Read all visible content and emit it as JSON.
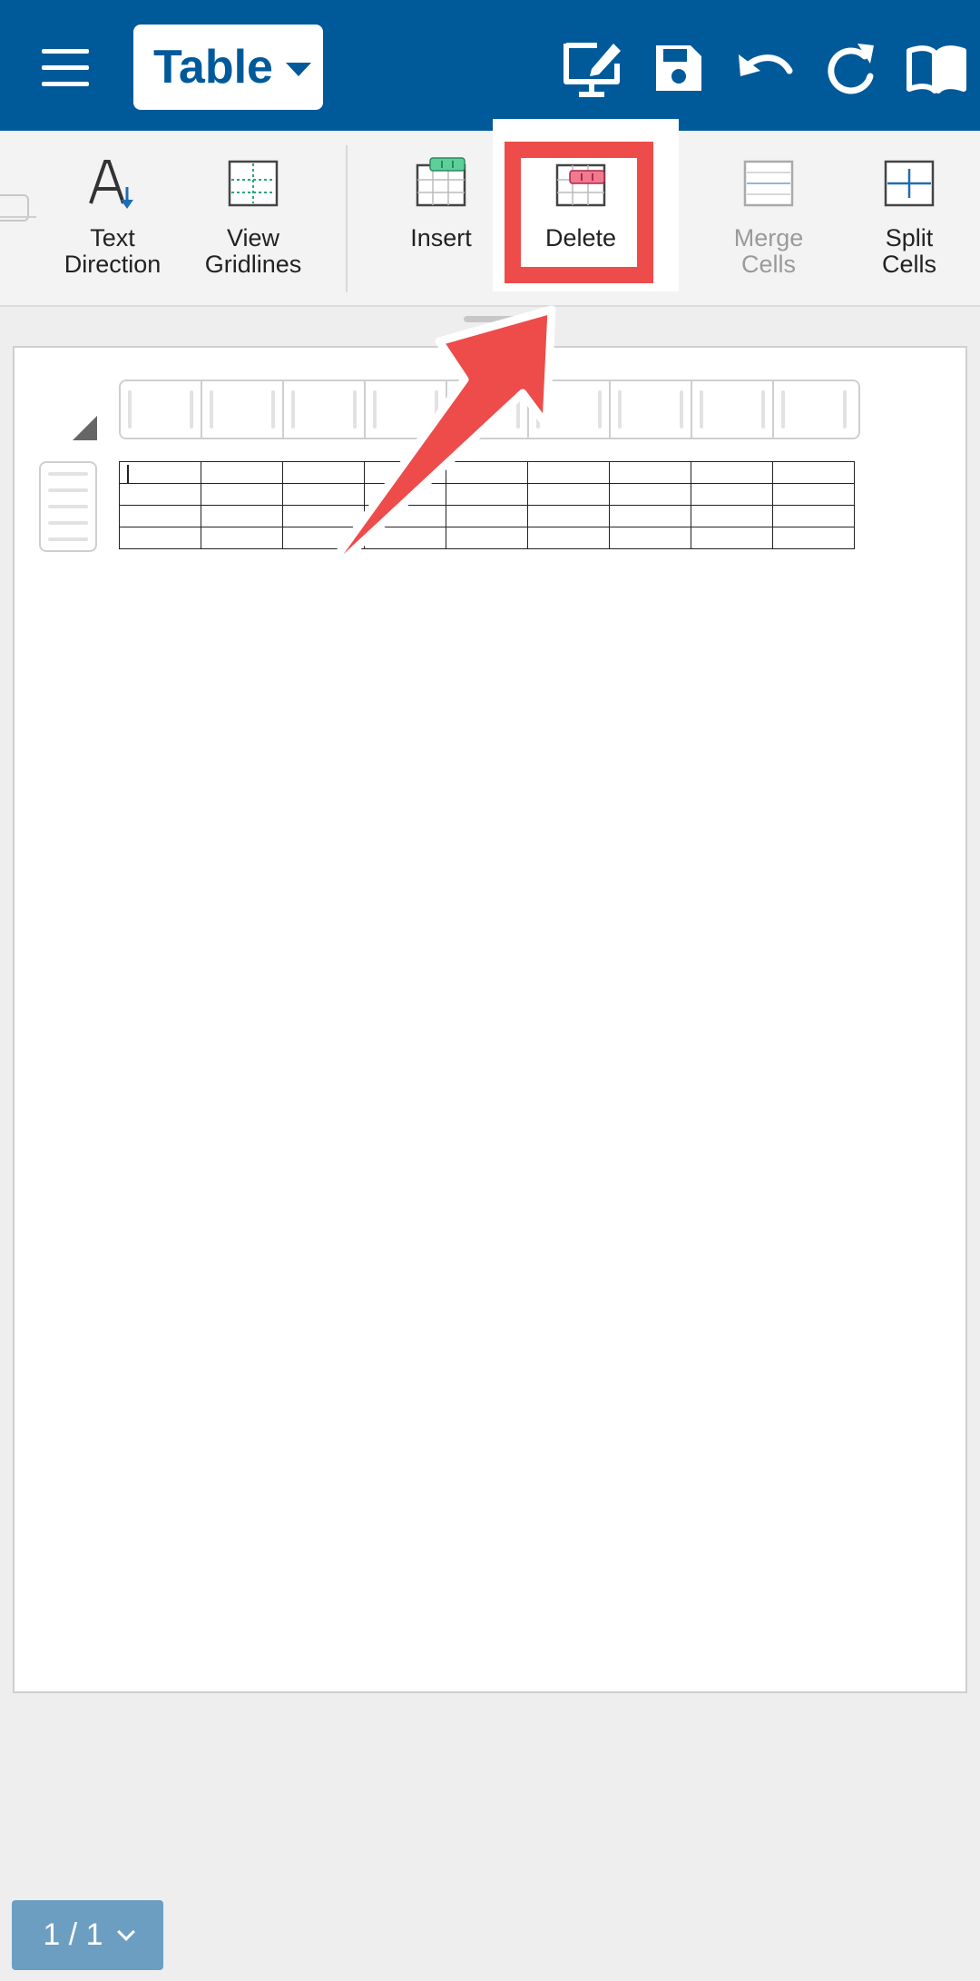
{
  "toolbar": {
    "mode_label": "Table",
    "icons": [
      "menu-icon",
      "edit-screen-icon",
      "save-icon",
      "undo-icon",
      "redo-icon",
      "book-icon"
    ]
  },
  "ribbon": {
    "items": [
      {
        "label": "Text\nDirection",
        "icon": "text-direction-icon",
        "enabled": true
      },
      {
        "label": "View\nGridlines",
        "icon": "gridlines-icon",
        "enabled": true
      },
      {
        "label": "Insert",
        "icon": "insert-table-icon",
        "enabled": true
      },
      {
        "label": "Delete",
        "icon": "delete-table-icon",
        "enabled": true
      },
      {
        "label": "Merge\nCells",
        "icon": "merge-cells-icon",
        "enabled": false
      },
      {
        "label": "Split\nCells",
        "icon": "split-cells-icon",
        "enabled": true
      }
    ]
  },
  "document": {
    "table": {
      "rows": 4,
      "columns": 9
    }
  },
  "page_indicator": {
    "label": "1 / 1"
  },
  "colors": {
    "primary": "#005a9a",
    "highlight": "#ee4b4b",
    "insert_accent": "#5ecf9a",
    "delete_accent": "#f07a90",
    "page_indicator": "#6c9ec2"
  }
}
